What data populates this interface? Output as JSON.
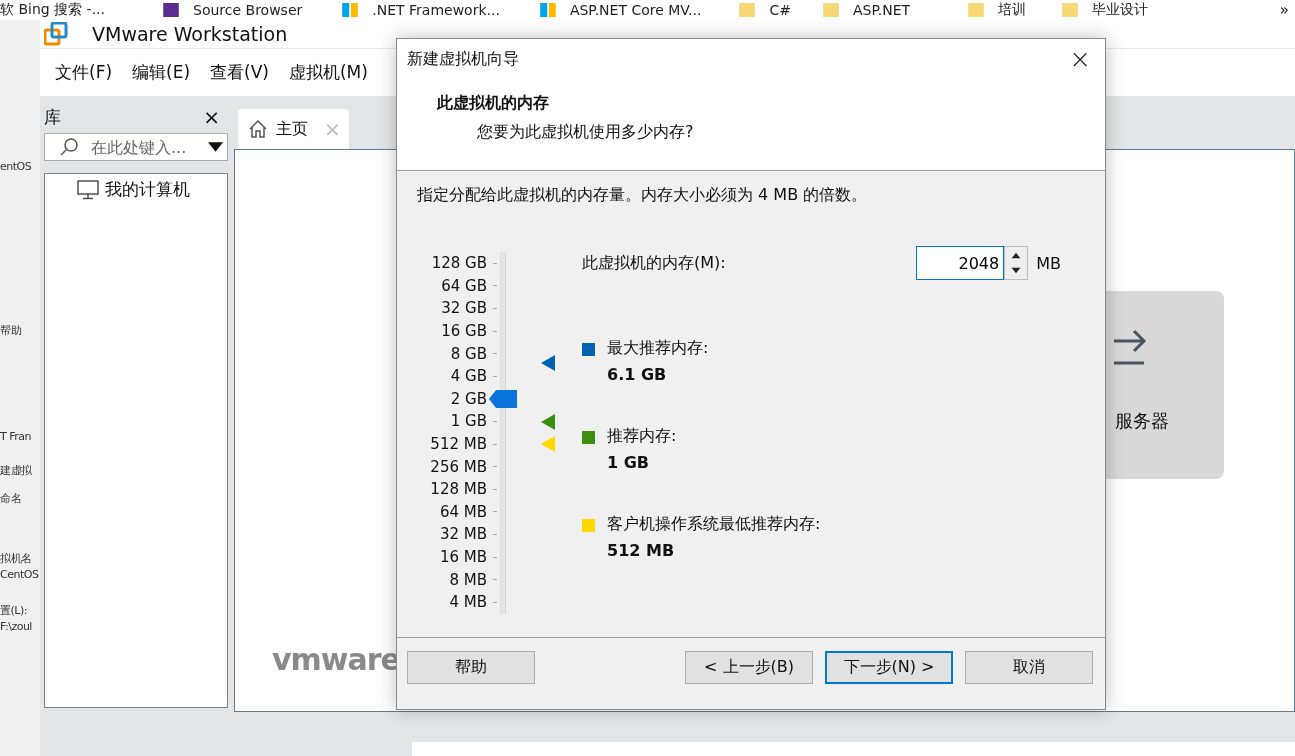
{
  "bookmarks": [
    {
      "kind": "none",
      "label": "软 Bing 搜索 -..."
    },
    {
      "kind": "net",
      "label": "Source Browser"
    },
    {
      "kind": "windows",
      "label": ".NET Framework..."
    },
    {
      "kind": "windows",
      "label": "ASP.NET Core MV..."
    },
    {
      "kind": "folder",
      "label": "C#"
    },
    {
      "kind": "folder",
      "label": "ASP.NET"
    },
    {
      "kind": "folder",
      "label": "培训"
    },
    {
      "kind": "folder",
      "label": "毕业设计"
    }
  ],
  "bookmarks_more": "»",
  "background_window": {
    "texts": [
      "entOS",
      "帮助",
      "T Fran",
      "建虚拟",
      "命名",
      "拟机名",
      "CentOS",
      "置(L):",
      "F:\\zoul"
    ]
  },
  "app": {
    "title": "VMware Workstation",
    "menu": [
      "文件(F)",
      "编辑(E)",
      "查看(V)",
      "虚拟机(M)"
    ],
    "library": {
      "title": "库",
      "close": "×",
      "search": {
        "placeholder": "在此处键入..."
      },
      "tree": [
        {
          "label": "我的计算机"
        }
      ]
    },
    "tabs": [
      {
        "label": "主页",
        "selected": true,
        "close": "×"
      }
    ],
    "home": {
      "cards": [
        {
          "label": "服务器"
        }
      ],
      "logo": "vmware"
    }
  },
  "dialog": {
    "title": "新建虚拟机向导",
    "close": "×",
    "heading": "此虚拟机的内存",
    "subheading": "您要为此虚拟机使用多少内存?",
    "instruction": "指定分配给此虚拟机的内存量。内存大小必须为 4 MB 的倍数。",
    "slider": {
      "ticks": [
        "128 GB",
        "64 GB",
        "32 GB",
        "16 GB",
        "8 GB",
        "4 GB",
        "2 GB",
        "1 GB",
        "512 MB",
        "256 MB",
        "128 MB",
        "64 MB",
        "32 MB",
        "16 MB",
        "8 MB",
        "4 MB"
      ],
      "level": 0.6,
      "markers": [
        {
          "level": 0.707,
          "color": "#0063b1"
        },
        {
          "level": 0.533,
          "color": "#3b8e10"
        },
        {
          "level": 0.467,
          "color": "#ffd800"
        }
      ]
    },
    "memory_field": {
      "label": "此虚拟机的内存(M):",
      "value": "2048",
      "unit": "MB"
    },
    "legend": [
      {
        "label": "最大推荐内存:",
        "value": "6.1 GB",
        "color": "#0063b1"
      },
      {
        "label": "推荐内存:",
        "value": "1 GB",
        "color": "#3b8e10"
      },
      {
        "label": "客户机操作系统最低推荐内存:",
        "value": "512 MB",
        "color": "#ffd800"
      }
    ],
    "buttons": [
      {
        "label": "帮助",
        "default": false
      },
      {
        "label": "< 上一步(B)",
        "default": false
      },
      {
        "label": "下一步(N) >",
        "default": true
      },
      {
        "label": "取消",
        "default": false
      }
    ]
  }
}
